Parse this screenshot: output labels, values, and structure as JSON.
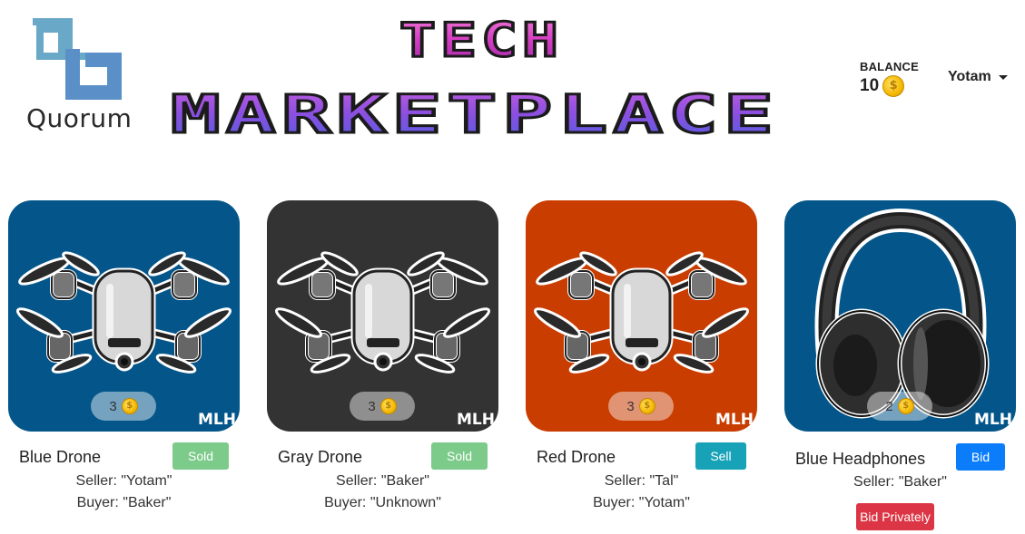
{
  "header": {
    "logo_text": "Quorum",
    "title_line1": "TECH",
    "title_line2": "MARKETPLACE"
  },
  "balance": {
    "label": "BALANCE",
    "value": "10",
    "icon": "coin-icon"
  },
  "user": {
    "name": "Yotam",
    "icon": "caret-down-icon"
  },
  "watermark": "MLH",
  "colors": {
    "card_blue": "#04568a",
    "card_gray": "#333333",
    "card_orange": "#c93d00",
    "sold_green": "#7ccb8a",
    "sell_teal": "#17a2b8",
    "bid_blue": "#0b7dfb",
    "bid_private_red": "#dc3545"
  },
  "cards": [
    {
      "name": "Blue Drone",
      "price": "3",
      "action": "Sold",
      "seller": "Seller: \"Yotam\"",
      "buyer": "Buyer: \"Baker\""
    },
    {
      "name": "Gray Drone",
      "price": "3",
      "action": "Sold",
      "seller": "Seller: \"Baker\"",
      "buyer": "Buyer: \"Unknown\""
    },
    {
      "name": "Red Drone",
      "price": "3",
      "action": "Sell",
      "seller": "Seller: \"Tal\"",
      "buyer": "Buyer: \"Yotam\""
    },
    {
      "name": "Blue Headphones",
      "price": "2",
      "action": "Bid",
      "seller": "Seller: \"Baker\"",
      "secondary_action": "Bid Privately"
    }
  ]
}
